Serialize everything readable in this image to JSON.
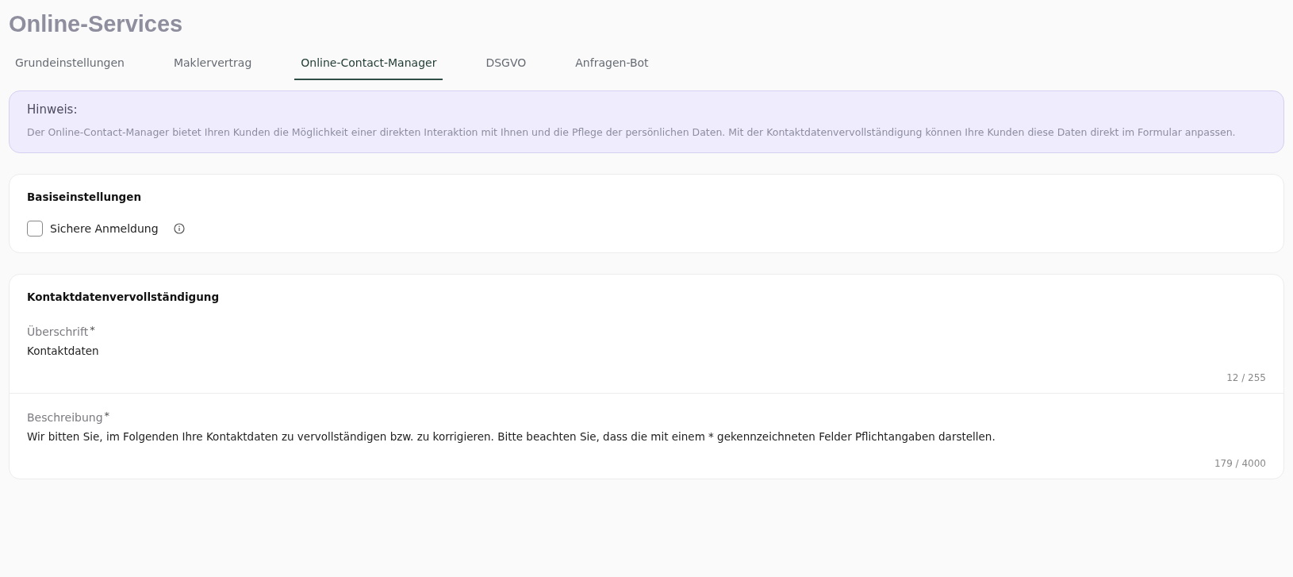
{
  "title": "Online-Services",
  "tabs": [
    {
      "label": "Grundeinstellungen",
      "selected": false
    },
    {
      "label": "Maklervertrag",
      "selected": false
    },
    {
      "label": "Online-Contact-Manager",
      "selected": true
    },
    {
      "label": "DSGVO",
      "selected": false
    },
    {
      "label": "Anfragen-Bot",
      "selected": false
    }
  ],
  "notice": {
    "heading": "Hinweis:",
    "text": "Der Online-Contact-Manager bietet Ihren Kunden die Möglichkeit einer direkten Interaktion mit Ihnen und die Pflege der persönlichen Daten. Mit der Kontaktdatenvervollständigung können Ihre Kunden diese Daten direkt im Formular anpassen."
  },
  "basic_settings": {
    "heading": "Basiseinstellungen",
    "options": [
      {
        "label": "Sichere Anmeldung",
        "checked": false
      }
    ]
  },
  "contact_completion": {
    "heading": "Kontaktdatenvervollständigung",
    "fields": [
      {
        "label": "Überschrift",
        "required_mark": "*",
        "value": "Kontaktdaten",
        "counter": "12 / 255"
      },
      {
        "label": "Beschreibung",
        "required_mark": "*",
        "value": "Wir bitten Sie, im Folgenden Ihre Kontaktdaten zu vervollständigen bzw. zu korrigieren. Bitte beachten Sie, dass die mit einem * gekennzeichneten Felder Pflichtangaben darstellen.",
        "counter": "179 / 4000"
      }
    ]
  }
}
